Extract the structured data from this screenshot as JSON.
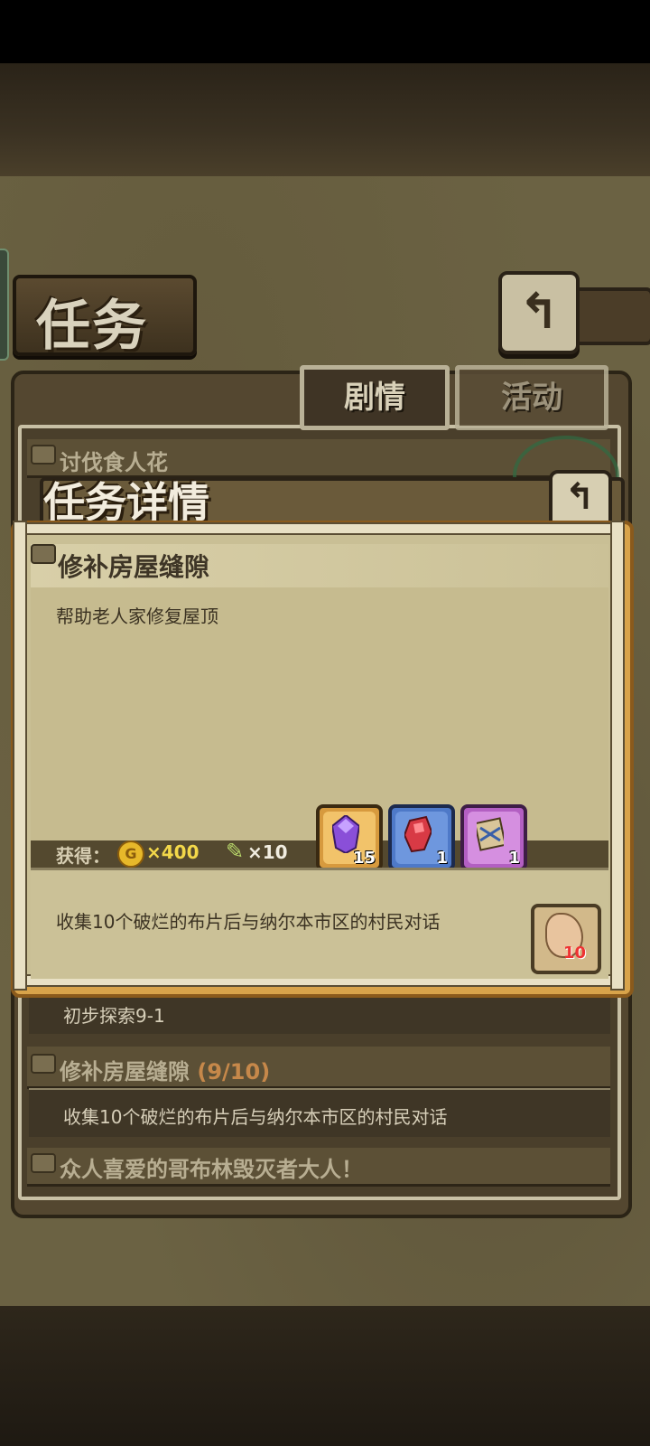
{
  "quest_screen": {
    "title": "任务",
    "tabs": [
      {
        "label": "剧情",
        "active": true
      },
      {
        "label": "活动",
        "active": false
      }
    ]
  },
  "quest_list": [
    {
      "title": "讨伐食人花"
    },
    {
      "subtitle": "初步探索9-1"
    },
    {
      "title": "修补房屋缝隙",
      "progress": "(9/10)",
      "description": "收集10个破烂的布片后与纳尔本市区的村民对话"
    },
    {
      "title": "众人喜爱的哥布林毁灭者大人！"
    }
  ],
  "detail_modal": {
    "title": "任务详情",
    "quest_title": "修补房屋缝隙",
    "description": "帮助老人家修复屋顶",
    "rewards_label": "获得：",
    "gold": "×400",
    "feather": "×10",
    "items": [
      {
        "name": "purple-crystal",
        "count": "15"
      },
      {
        "name": "red-ore",
        "count": "1"
      },
      {
        "name": "scroll-map",
        "count": "1"
      }
    ],
    "objective": "收集10个破烂的布片后与纳尔本市区的村民对话",
    "required_item_count": "10"
  }
}
